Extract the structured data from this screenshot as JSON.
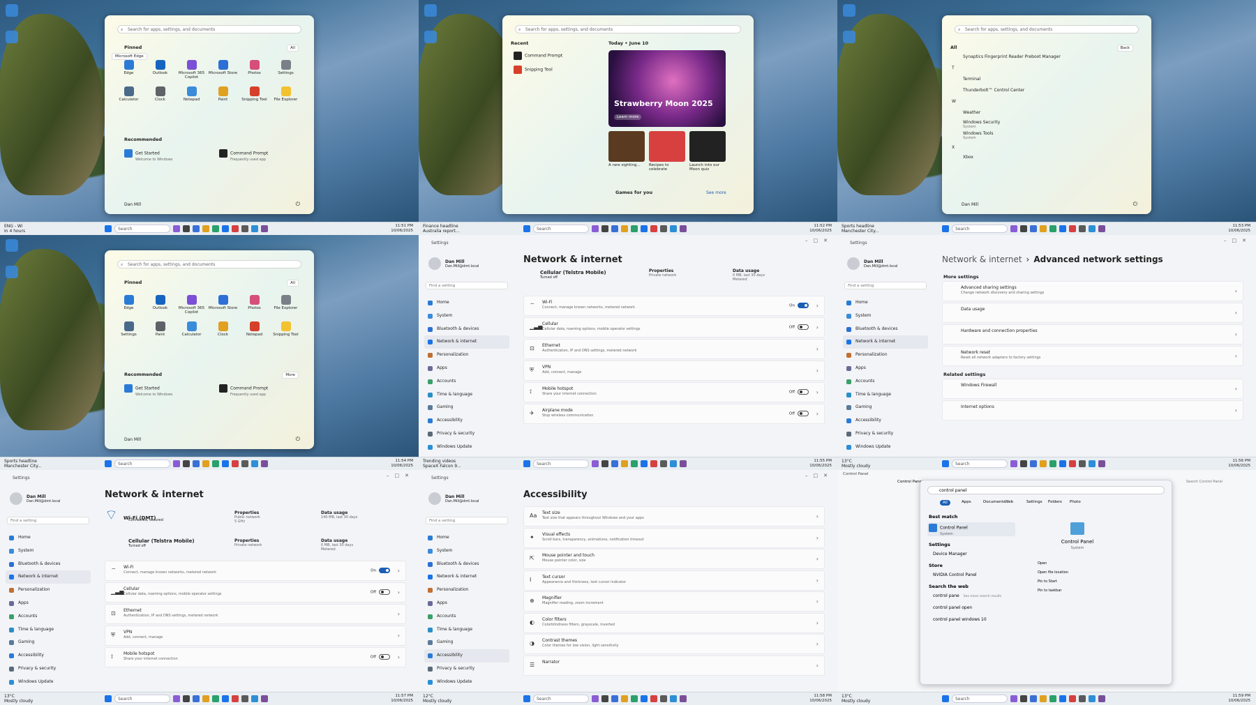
{
  "taskbar": {
    "search": "Search"
  },
  "panels": [
    {
      "left": {
        "l1": "ENG - Wi",
        "l2": "In 4 hours"
      },
      "time": "11:51 PM",
      "date": "10/06/2025"
    },
    {
      "left": {
        "l1": "Finance headline",
        "l2": "Australia report..."
      },
      "time": "11:52 PM",
      "date": "10/06/2025"
    },
    {
      "left": {
        "l1": "Sports headline",
        "l2": "Manchester City..."
      },
      "time": "11:53 PM",
      "date": "10/06/2025"
    },
    {
      "left": {
        "l1": "Sports headline",
        "l2": "Manchester City..."
      },
      "time": "11:54 PM",
      "date": "10/06/2025"
    },
    {
      "left": {
        "l1": "Trending videos",
        "l2": "SpaceX Falcon 9..."
      },
      "time": "11:55 PM",
      "date": "10/06/2025"
    },
    {
      "left": {
        "l1": "13°C",
        "l2": "Mostly cloudy"
      },
      "time": "11:56 PM",
      "date": "10/06/2025"
    },
    {
      "left": {
        "l1": "13°C",
        "l2": "Mostly cloudy"
      },
      "time": "11:57 PM",
      "date": "10/06/2025"
    },
    {
      "left": {
        "l1": "12°C",
        "l2": "Mostly cloudy"
      },
      "time": "11:58 PM",
      "date": "10/06/2025"
    },
    {
      "left": {
        "l1": "13°C",
        "l2": "Mostly cloudy"
      },
      "time": "11:59 PM",
      "date": "10/06/2025"
    }
  ],
  "start": {
    "search_placeholder": "Search for apps, settings, and documents",
    "pinned": "Pinned",
    "all": "All",
    "recommended": "Recommended",
    "more": "More",
    "tooltip": "Microsoft Edge",
    "user": "Dan Mill",
    "apps1": [
      "Edge",
      "Outlook",
      "Microsoft 365 Copilot",
      "Microsoft Store",
      "Photos",
      "Settings",
      "Calculator",
      "Clock",
      "Notepad",
      "Paint",
      "Snipping Tool",
      "File Explorer"
    ],
    "apps4": [
      "Edge",
      "Outlook",
      "Microsoft 365 Copilot",
      "Microsoft Store",
      "Photos",
      "File Explorer",
      "Settings",
      "Paint",
      "Calculator",
      "Clock",
      "Notepad",
      "Snipping Tool"
    ],
    "rec": [
      {
        "t": "Get Started",
        "s": "Welcome to Windows"
      },
      {
        "t": "Command Prompt",
        "s": "Frequently used app"
      }
    ]
  },
  "search2": {
    "recent": "Recent",
    "recent_items": [
      "Command Prompt",
      "Snipping Tool"
    ],
    "today": "Today • June 10",
    "hero": "Strawberry Moon 2025",
    "learn": "Learn more",
    "cards": [
      "A rare sighting...",
      "Recipes to celebrate",
      "Launch into our Moon quiz"
    ],
    "games": "Games for you",
    "see_more": "See more"
  },
  "allapps": {
    "all": "All",
    "back": "Back",
    "items": [
      "Synaptics Fingerprint Reader Preboot Manager",
      "T",
      "Terminal",
      "Thunderbolt™ Control Center",
      "W",
      "Weather",
      "Windows Security",
      "System",
      "Windows Tools",
      "System",
      "X",
      "Xbox"
    ]
  },
  "settings": {
    "title": "Settings",
    "user": "Dan Mill",
    "email": "Dan.Mill@dmt.local",
    "find": "Find a setting",
    "nav": [
      "Home",
      "System",
      "Bluetooth & devices",
      "Network & internet",
      "Personalization",
      "Apps",
      "Accounts",
      "Time & language",
      "Gaming",
      "Accessibility",
      "Privacy & security",
      "Windows Update"
    ]
  },
  "net": {
    "title": "Network & internet",
    "cell": "Cellular (Telstra Mobile)",
    "cell_sub": "Turned off",
    "props": "Properties",
    "props_sub": "Private network",
    "usage": "Data usage",
    "usage_sub": "0 MB, last 30 days",
    "metered": "Metered",
    "rows": [
      {
        "t": "Wi-Fi",
        "s": "Connect, manage known networks, metered network",
        "tog": "On"
      },
      {
        "t": "Cellular",
        "s": "Cellular data, roaming options, mobile operator settings",
        "tog": "Off"
      },
      {
        "t": "Ethernet",
        "s": "Authentication, IP and DNS settings, metered network",
        "tog": ""
      },
      {
        "t": "VPN",
        "s": "Add, connect, manage",
        "tog": ""
      },
      {
        "t": "Mobile hotspot",
        "s": "Share your internet connection",
        "tog": "Off"
      },
      {
        "t": "Airplane mode",
        "s": "Stop wireless communication",
        "tog": "Off"
      }
    ]
  },
  "adv": {
    "crumb1": "Network & internet",
    "crumb2": "Advanced network settings",
    "more": "More settings",
    "related": "Related settings",
    "rows": [
      {
        "t": "Advanced sharing settings",
        "s": "Change network discovery and sharing settings"
      },
      {
        "t": "Data usage",
        "s": ""
      },
      {
        "t": "Hardware and connection properties",
        "s": ""
      },
      {
        "t": "Network reset",
        "s": "Reset all network adapters to factory settings"
      }
    ],
    "rel": [
      "Windows Firewall",
      "Internet options"
    ]
  },
  "net7": {
    "wifi": "Wi-Fi (DMT)",
    "wifi_sub": "Connected, secured",
    "props_sub": "Public network",
    "props_sub2": "5 GHz",
    "usage_sub": "140 MB, last 30 days"
  },
  "acc": {
    "title": "Accessibility",
    "rows": [
      {
        "t": "Text size",
        "s": "Text size that appears throughout Windows and your apps"
      },
      {
        "t": "Visual effects",
        "s": "Scroll bars, transparency, animations, notification timeout"
      },
      {
        "t": "Mouse pointer and touch",
        "s": "Mouse pointer color, size"
      },
      {
        "t": "Text cursor",
        "s": "Appearance and thickness, text cursor indicator"
      },
      {
        "t": "Magnifier",
        "s": "Magnifier reading, zoom increment"
      },
      {
        "t": "Color filters",
        "s": "Colorblindness filters, grayscale, inverted"
      },
      {
        "t": "Contrast themes",
        "s": "Color themes for low vision, light sensitivity"
      },
      {
        "t": "Narrator",
        "s": ""
      }
    ]
  },
  "cp": {
    "window": "Control Panel",
    "crumb": "Control Panel",
    "search_cp": "Search Control Panel",
    "query": "control panel",
    "tabs": [
      "All",
      "Apps",
      "Documents",
      "Web",
      "Settings",
      "Folders",
      "Photo"
    ],
    "best": "Best match",
    "best_item": "Control Panel",
    "best_sub": "System",
    "settings": "Settings",
    "dev": "Device Manager",
    "store": "Store",
    "nvidia": "NVIDIA Control Panel",
    "web": "Search the web",
    "web_items": [
      "control pane",
      "control panel open",
      "control panel windows 10"
    ],
    "see_web": "See more search results",
    "right_title": "Control Panel",
    "right_sub": "System",
    "actions": [
      "Open",
      "Open file location",
      "Pin to Start",
      "Pin to taskbar"
    ]
  }
}
